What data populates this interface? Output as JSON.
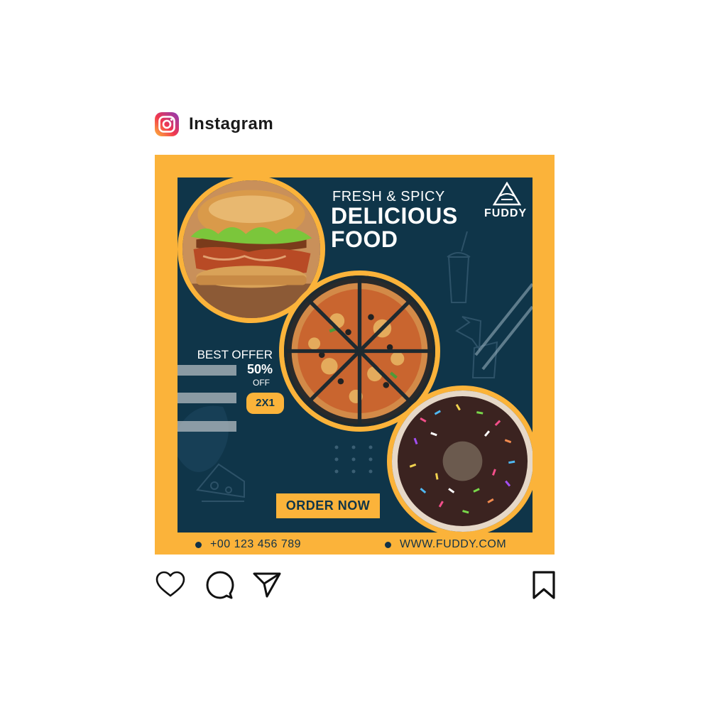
{
  "app": {
    "name": "Instagram",
    "logo_icon": "instagram-logo-icon"
  },
  "post": {
    "headline_small": "FRESH & SPICY",
    "headline_line1": "DELICIOUS",
    "headline_line2": "FOOD",
    "brand": "FUDDY",
    "offer": {
      "label": "BEST OFFER",
      "percent": "50%",
      "off": "OFF",
      "badge": "2X1"
    },
    "cta": "ORDER NOW",
    "phone": "+00 123 456 789",
    "website": "WWW.FUDDY.COM",
    "colors": {
      "accent": "#fbb33a",
      "panel": "#0f3549",
      "text_dark": "#123247"
    },
    "images": [
      "burger",
      "pizza",
      "chocolate-donut"
    ]
  },
  "actions": {
    "like": "heart-icon",
    "comment": "comment-icon",
    "share": "send-icon",
    "save": "bookmark-icon"
  }
}
